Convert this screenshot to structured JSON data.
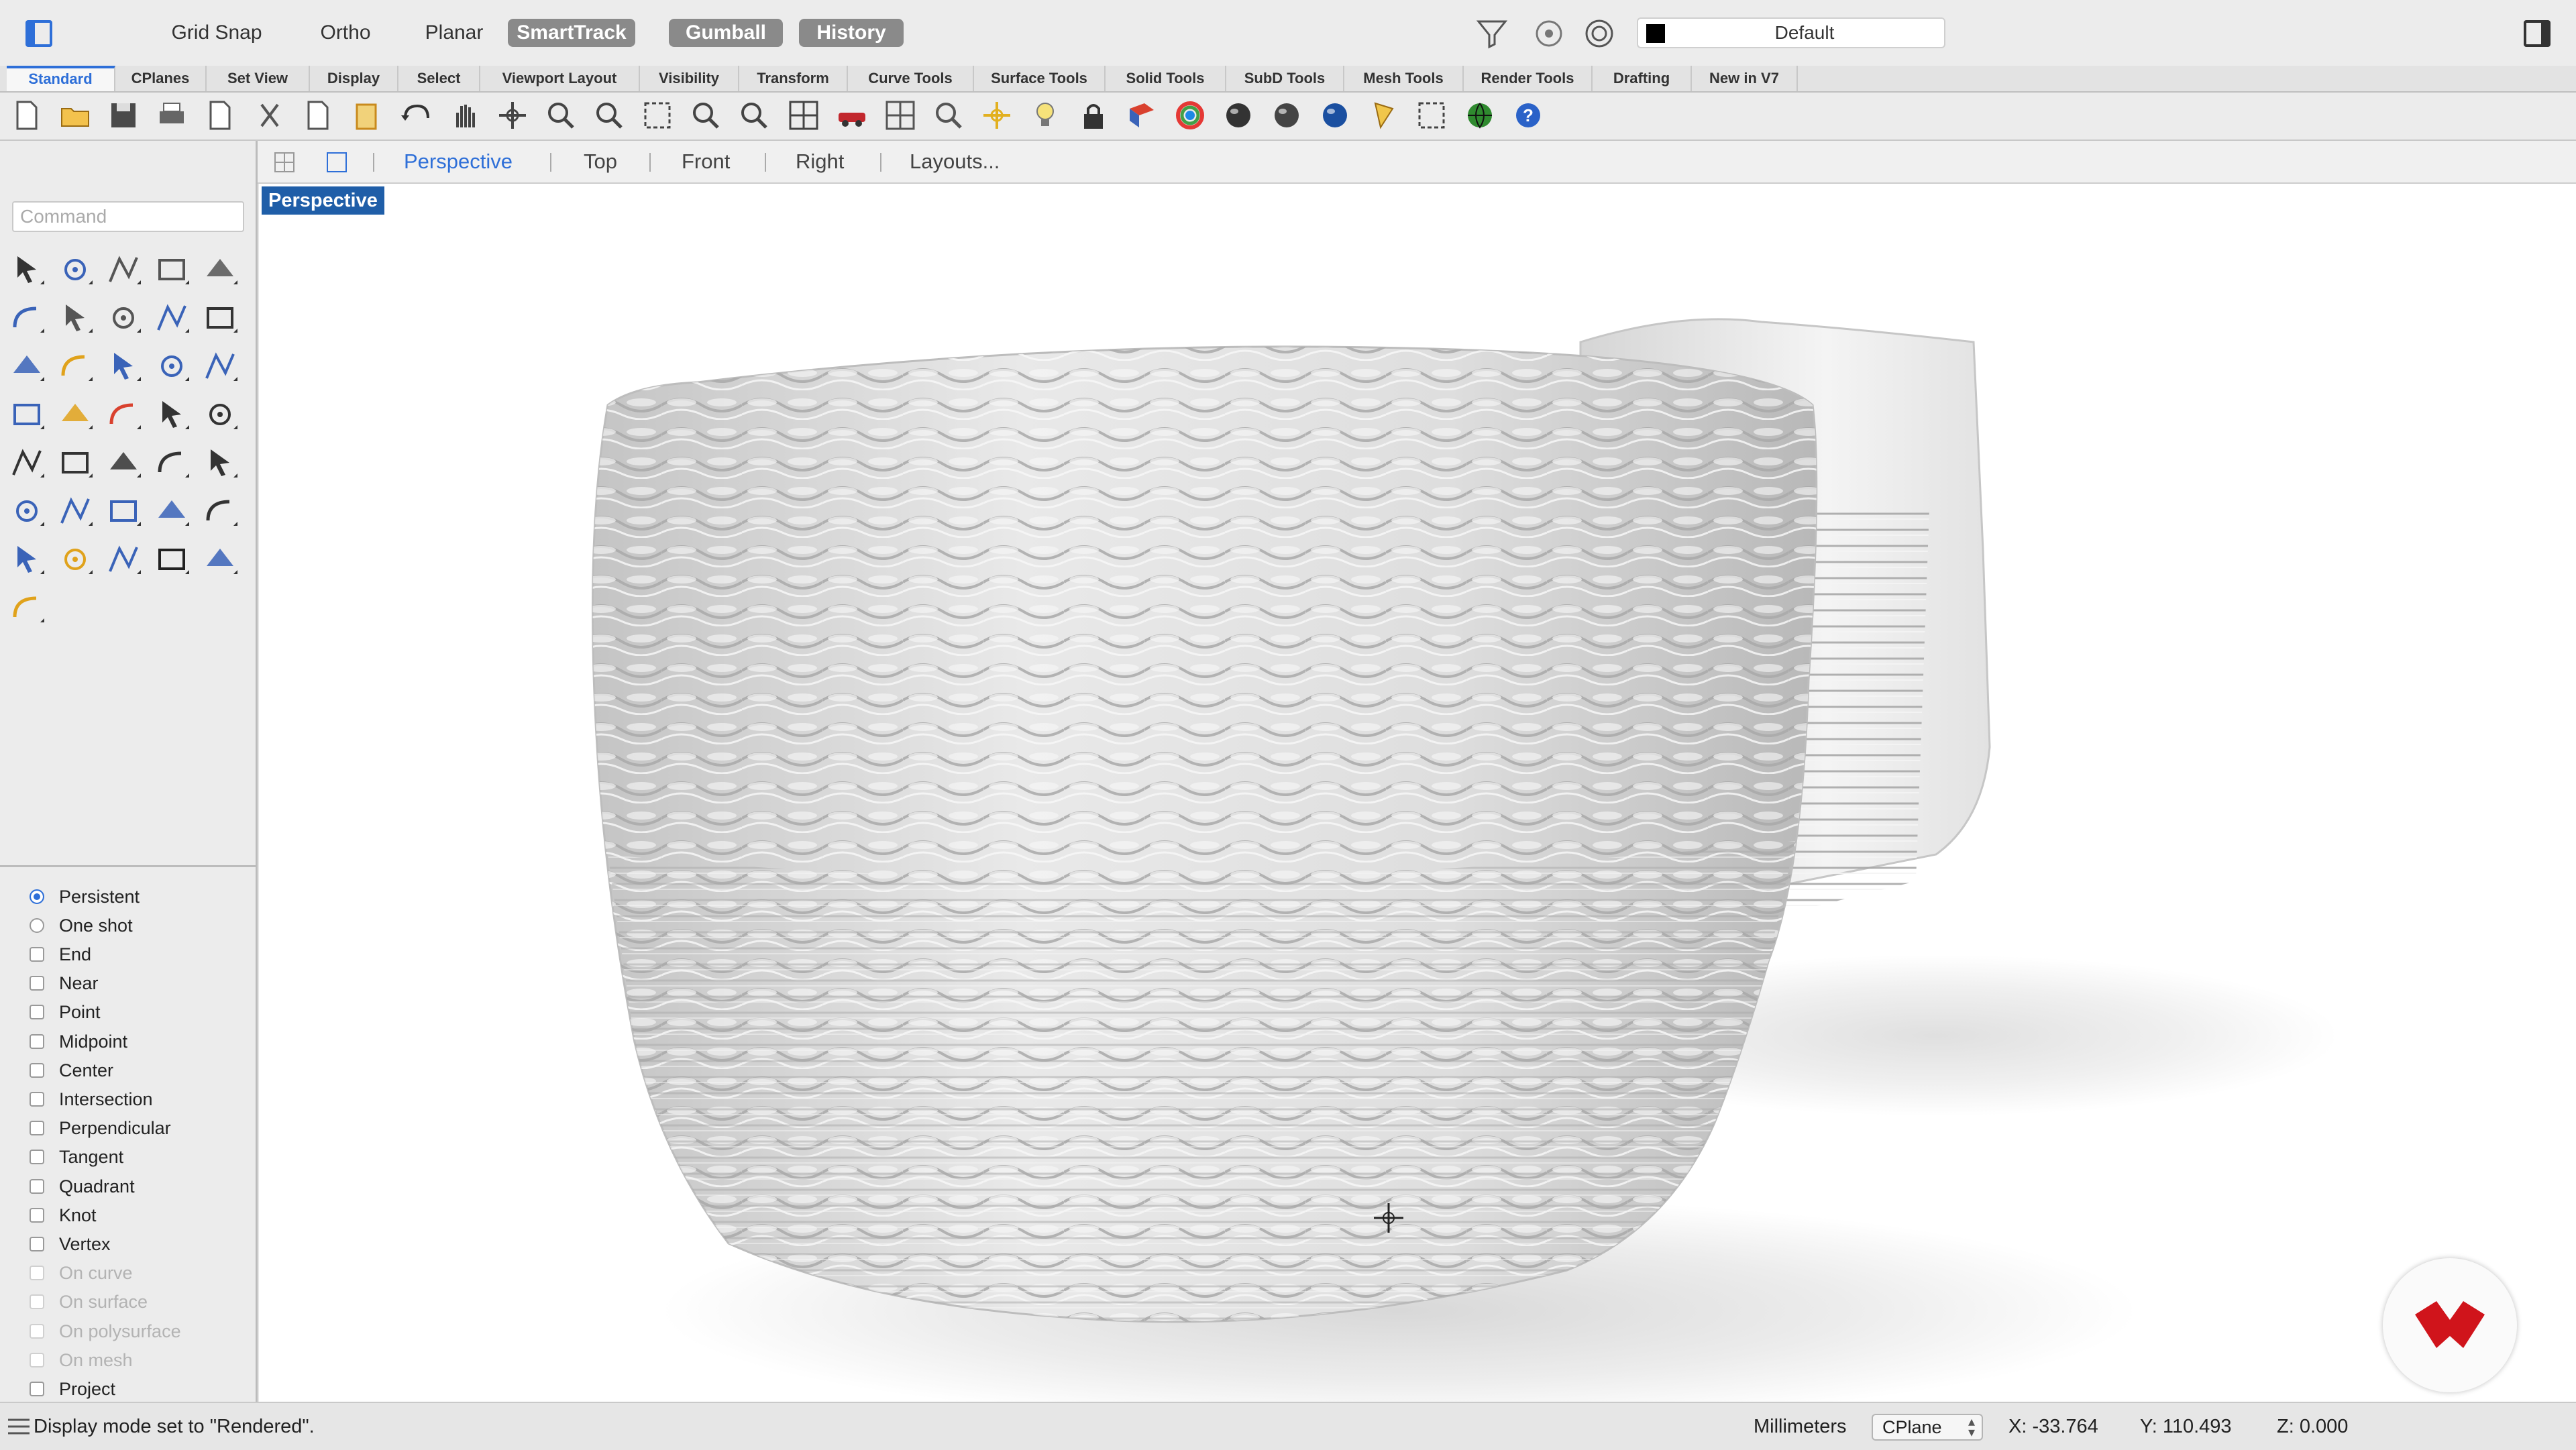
{
  "top_bar": {
    "modes": [
      {
        "label": "Grid Snap",
        "on": false
      },
      {
        "label": "Ortho",
        "on": false
      },
      {
        "label": "Planar",
        "on": false
      },
      {
        "label": "SmartTrack",
        "on": true
      },
      {
        "label": "Gumball",
        "on": true
      },
      {
        "label": "History",
        "on": true
      }
    ],
    "layer": "Default",
    "icons": [
      "filter-icon",
      "record-icon",
      "target-icon",
      "left-panel-toggle-icon",
      "right-panel-toggle-icon"
    ]
  },
  "tabs": [
    "Standard",
    "CPlanes",
    "Set View",
    "Display",
    "Select",
    "Viewport Layout",
    "Visibility",
    "Transform",
    "Curve Tools",
    "Surface Tools",
    "Solid Tools",
    "SubD Tools",
    "Mesh Tools",
    "Render Tools",
    "Drafting",
    "New in V7"
  ],
  "active_tab": "Standard",
  "toolbar_icons": [
    "new-file-icon",
    "open-icon",
    "save-icon",
    "print-icon",
    "import-icon",
    "cut-icon",
    "copy-icon",
    "paste-icon",
    "undo-icon",
    "pan-hand-icon",
    "rotate-view-icon",
    "zoom-icon",
    "zoom-window-icon",
    "zoom-extents-icon",
    "zoom-selected-icon",
    "zoom-previous-icon",
    "four-view-icon",
    "car-icon",
    "grid-icon",
    "cplane-icon",
    "gumball-icon",
    "light-bulb-icon",
    "lock-icon",
    "material-icon",
    "color-wheel-icon",
    "wireframe-sphere-icon",
    "mesh-sphere-icon",
    "rendered-sphere-icon",
    "spotlight-icon",
    "dimension-icon",
    "globe-icon",
    "help-icon"
  ],
  "command": {
    "placeholder": "Command"
  },
  "viewport_tabs": {
    "items": [
      "Perspective",
      "Top",
      "Front",
      "Right",
      "Layouts..."
    ],
    "active": "Perspective"
  },
  "viewport": {
    "label": "Perspective"
  },
  "osnap": {
    "modes": [
      {
        "label": "Persistent",
        "type": "radio",
        "checked": true
      },
      {
        "label": "One shot",
        "type": "radio",
        "checked": false
      }
    ],
    "items": [
      {
        "label": "End",
        "enabled": true
      },
      {
        "label": "Near",
        "enabled": true
      },
      {
        "label": "Point",
        "enabled": true
      },
      {
        "label": "Midpoint",
        "enabled": true
      },
      {
        "label": "Center",
        "enabled": true
      },
      {
        "label": "Intersection",
        "enabled": true
      },
      {
        "label": "Perpendicular",
        "enabled": true
      },
      {
        "label": "Tangent",
        "enabled": true
      },
      {
        "label": "Quadrant",
        "enabled": true
      },
      {
        "label": "Knot",
        "enabled": true
      },
      {
        "label": "Vertex",
        "enabled": true
      },
      {
        "label": "On curve",
        "enabled": false
      },
      {
        "label": "On surface",
        "enabled": false
      },
      {
        "label": "On polysurface",
        "enabled": false
      },
      {
        "label": "On mesh",
        "enabled": false
      },
      {
        "label": "Project",
        "enabled": true
      }
    ]
  },
  "status": {
    "message": "Display mode set to \"Rendered\".",
    "units": "Millimeters",
    "cplane": "CPlane",
    "x": "X: -33.764",
    "y": "Y: 110.493",
    "z": "Z: 0.000"
  },
  "colors": {
    "accent": "#2e6fd8",
    "viewport_label_bg": "#1f5ea8",
    "toggle_on_bg": "#8a8a8a",
    "logo_red": "#d0141b"
  }
}
